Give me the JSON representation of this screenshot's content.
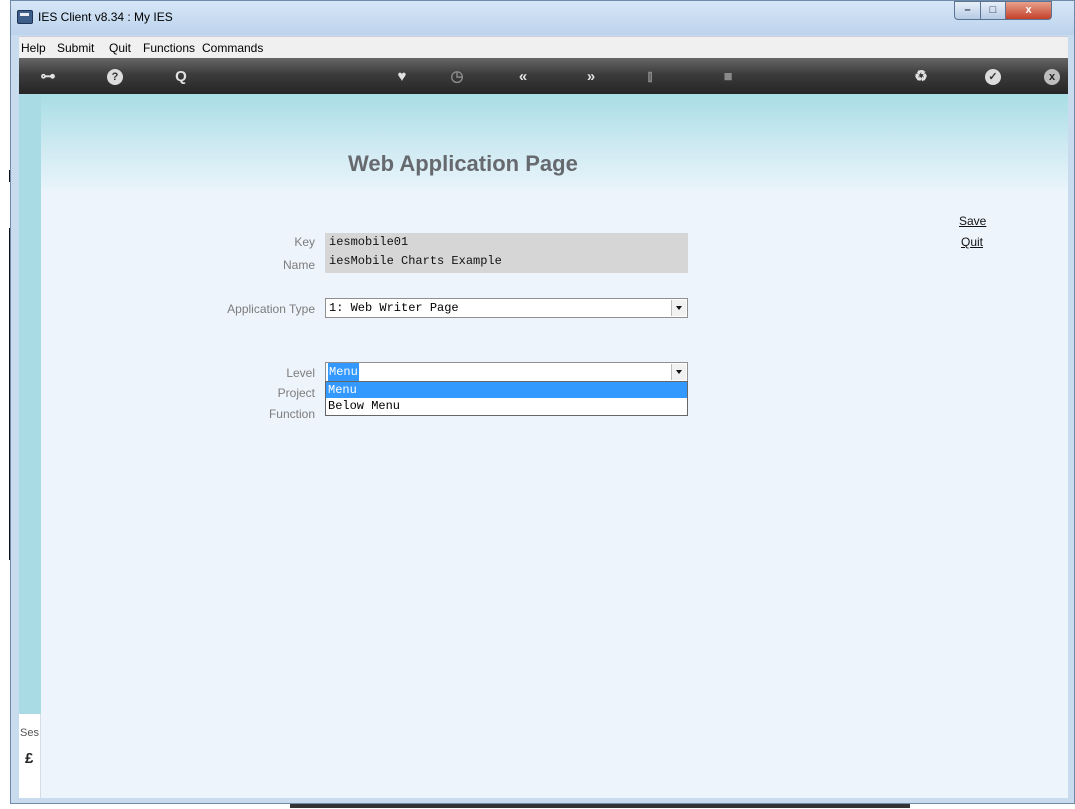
{
  "window": {
    "title": "IES Client v8.34 : My IES",
    "controls": {
      "minimize": "–",
      "maximize": "□",
      "close": "x"
    }
  },
  "menubar": {
    "items": [
      "Help",
      "Submit",
      "Quit",
      "Functions",
      "Commands"
    ]
  },
  "toolbar": {
    "icons": [
      "key-icon",
      "help-icon",
      "search-icon",
      "heart-icon",
      "clock-icon",
      "previous-icon",
      "next-icon",
      "tools-icon",
      "stop-icon",
      "recycle-icon",
      "check-icon",
      "close-icon"
    ]
  },
  "page": {
    "title": "Web Application Page",
    "actions": {
      "save": "Save",
      "quit": "Quit"
    },
    "fields": {
      "key": {
        "label": "Key",
        "value": "iesmobile01"
      },
      "name": {
        "label": "Name",
        "value": "iesMobile Charts Example"
      },
      "application_type": {
        "label": "Application Type",
        "value": "1: Web Writer Page"
      },
      "level": {
        "label": "Level",
        "value": "Menu",
        "options": [
          "Menu",
          "Below Menu"
        ]
      },
      "project": {
        "label": "Project"
      },
      "function": {
        "label": "Function"
      }
    }
  },
  "sidebar": {
    "session_label": "Ses"
  },
  "colors": {
    "accent": "#3399ff",
    "header_band": "#a8dde5",
    "content_bg": "#eef4fc",
    "toolbar": "#3c3c3c"
  }
}
